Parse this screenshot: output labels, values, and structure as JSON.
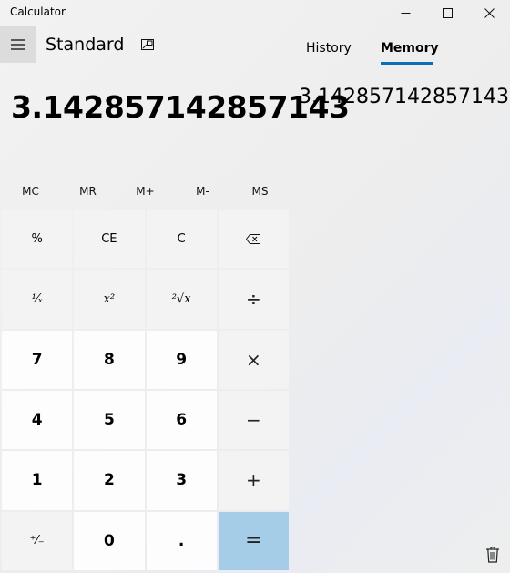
{
  "window": {
    "title": "Calculator"
  },
  "header": {
    "mode": "Standard"
  },
  "display": {
    "value": "3.142857142857143"
  },
  "tabs": [
    {
      "label": "History",
      "active": false
    },
    {
      "label": "Memory",
      "active": true
    }
  ],
  "memory": {
    "items": [
      "3.142857142857143"
    ]
  },
  "memory_buttons": [
    "MC",
    "MR",
    "M+",
    "M-",
    "MS"
  ],
  "keys": {
    "percent": "%",
    "clear_entry": "CE",
    "clear": "C",
    "reciprocal": "¹⁄ₓ",
    "square": "x²",
    "square_root": "²√x",
    "divide": "÷",
    "seven": "7",
    "eight": "8",
    "nine": "9",
    "multiply": "×",
    "four": "4",
    "five": "5",
    "six": "6",
    "minus": "−",
    "one": "1",
    "two": "2",
    "three": "3",
    "plus": "+",
    "negate": "⁺⁄₋",
    "zero": "0",
    "decimal": ".",
    "equals": "="
  },
  "colors": {
    "accent": "#0b6fb8",
    "equals_key": "#a6cde7",
    "hamburger_bg": "#dcdcdc"
  },
  "icons": {
    "hamburger": "hamburger-menu-icon",
    "keep_on_top": "keep-on-top-icon",
    "backspace": "backspace-icon",
    "trash": "trash-icon",
    "minimize": "minimize-icon",
    "maximize": "maximize-icon",
    "close": "close-icon"
  }
}
